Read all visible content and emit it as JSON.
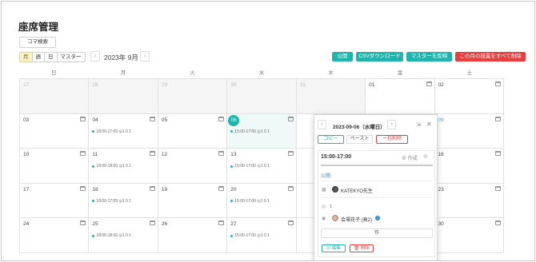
{
  "title": "座席管理",
  "koma_search": "コマ検索",
  "views": [
    "月",
    "週",
    "日",
    "マスター"
  ],
  "nav": {
    "prev": "‹",
    "next": "›"
  },
  "month_label": "2023年 9月",
  "actions": {
    "publish": "公開",
    "csv": "CSVダウンロード",
    "master": "マスターを反映",
    "delete_all": "この月の授業をすべて削除"
  },
  "weekdays": [
    "日",
    "月",
    "火",
    "水",
    "木",
    "金",
    "土"
  ],
  "weeks": [
    [
      {
        "d": "27",
        "muted": true
      },
      {
        "d": "28",
        "muted": true
      },
      {
        "d": "29",
        "muted": true
      },
      {
        "d": "30",
        "muted": true
      },
      {
        "d": "31",
        "muted": true
      },
      {
        "d": "01"
      },
      {
        "d": "02"
      }
    ],
    [
      {
        "d": "03"
      },
      {
        "d": "04",
        "slot": "18:00-17:00  ◎1 0 1"
      },
      {
        "d": "05"
      },
      {
        "d": "06",
        "today": true,
        "slot": "15:00-17:00  ◎1 0 1"
      },
      {
        "d": ""
      },
      {
        "d": ""
      },
      {
        "d": "09",
        "blue": true
      }
    ],
    [
      {
        "d": "10"
      },
      {
        "d": "11",
        "slot": "18:00-18:00  ◎1 0 1"
      },
      {
        "d": "12"
      },
      {
        "d": "13",
        "slot": "15:00-17:00  ◎1 0 1"
      },
      {
        "d": ""
      },
      {
        "d": ""
      },
      {
        "d": "16"
      }
    ],
    [
      {
        "d": "17"
      },
      {
        "d": "18",
        "slot": "18:00-17:00  ◎1 0 1"
      },
      {
        "d": "19"
      },
      {
        "d": "20",
        "slot": "15:00-17:00  ◎1 0 1"
      },
      {
        "d": ""
      },
      {
        "d": ""
      },
      {
        "d": "23"
      }
    ],
    [
      {
        "d": "24"
      },
      {
        "d": "25",
        "slot": "18:00-18:00  ◎1 0 1"
      },
      {
        "d": "26"
      },
      {
        "d": "27",
        "slot": "15:00-17:00  ◎1 0 1"
      },
      {
        "d": ""
      },
      {
        "d": ""
      },
      {
        "d": "30"
      }
    ]
  ],
  "popup": {
    "date": "2023-09-06（水曜日）",
    "copy": "コピー",
    "paste": "ペースト",
    "delete_all": "一括削除",
    "card": {
      "time": "15:00-17:00",
      "create": "⊕ 作成",
      "status": "公開",
      "teacher": "KATEKYO先生",
      "seat_count": "1",
      "student": "会場花子 (高2)",
      "add": "作",
      "edit": "☑ 編集",
      "delete": "🗑 削除"
    }
  }
}
